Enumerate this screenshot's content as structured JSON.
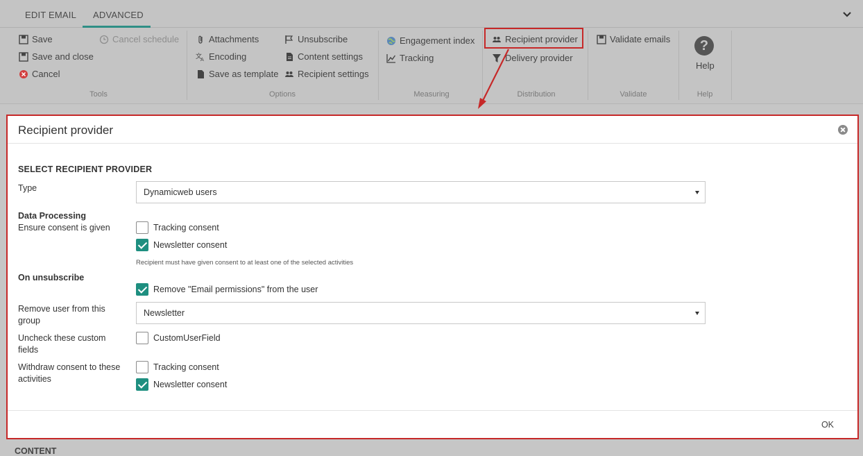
{
  "tabs": {
    "edit_email": "EDIT EMAIL",
    "advanced": "ADVANCED"
  },
  "ribbon": {
    "tools": {
      "save": "Save",
      "save_close": "Save and close",
      "cancel": "Cancel",
      "cancel_schedule": "Cancel schedule",
      "label": "Tools"
    },
    "options": {
      "attachments": "Attachments",
      "encoding": "Encoding",
      "save_template": "Save as template",
      "unsubscribe": "Unsubscribe",
      "content_settings": "Content settings",
      "recipient_settings": "Recipient settings",
      "label": "Options"
    },
    "measuring": {
      "engagement": "Engagement index",
      "tracking": "Tracking",
      "label": "Measuring"
    },
    "distribution": {
      "recipient_provider": "Recipient provider",
      "delivery_provider": "Delivery provider",
      "label": "Distribution"
    },
    "validate": {
      "validate_emails": "Validate emails",
      "label": "Validate"
    },
    "help": {
      "help": "Help",
      "label": "Help"
    }
  },
  "modal": {
    "title": "Recipient provider",
    "section_title": "SELECT RECIPIENT PROVIDER",
    "type_label": "Type",
    "type_value": "Dynamicweb users",
    "data_processing": "Data Processing",
    "ensure_consent": "Ensure consent is given",
    "tracking_consent": "Tracking consent",
    "newsletter_consent": "Newsletter consent",
    "consent_hint": "Recipient must have given consent to at least one of the selected activities",
    "on_unsubscribe": "On unsubscribe",
    "remove_permissions": "Remove \"Email permissions\" from the user",
    "remove_group_label": "Remove user from this group",
    "remove_group_value": "Newsletter",
    "uncheck_fields_label": "Uncheck these custom fields",
    "custom_field": "CustomUserField",
    "withdraw_label": "Withdraw consent to these activities",
    "withdraw_tracking": "Tracking consent",
    "withdraw_newsletter": "Newsletter consent",
    "ok": "OK"
  },
  "content_label": "CONTENT",
  "colors": {
    "accent": "#1e8f80",
    "highlight": "#c62828"
  }
}
